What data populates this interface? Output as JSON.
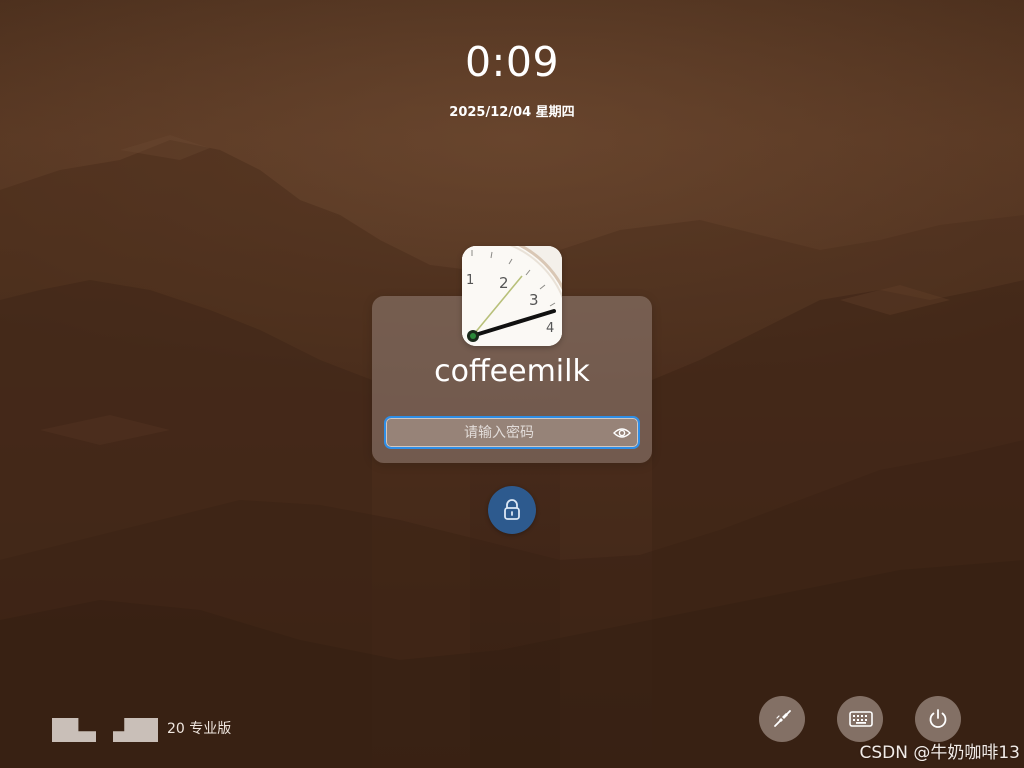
{
  "clock": {
    "time": "0:09",
    "date": "2025/12/04 星期四"
  },
  "user": {
    "name": "coffeemilk",
    "avatar_icon": "clock-face-avatar"
  },
  "password": {
    "placeholder": "请输入密码",
    "value": "",
    "toggle_icon": "eye-icon"
  },
  "unlock": {
    "icon": "lock-icon",
    "color": "#2d5a8e"
  },
  "bottom_left": {
    "edition": "20 专业版"
  },
  "bottom_right": {
    "buttons": [
      {
        "name": "network",
        "icon": "network-plug-icon"
      },
      {
        "name": "keyboard",
        "icon": "keyboard-icon"
      },
      {
        "name": "power",
        "icon": "power-icon"
      }
    ]
  },
  "watermark": "CSDN @牛奶咖啡13",
  "colors": {
    "accent": "#2f8ee6",
    "background": "#4a2e1c"
  }
}
